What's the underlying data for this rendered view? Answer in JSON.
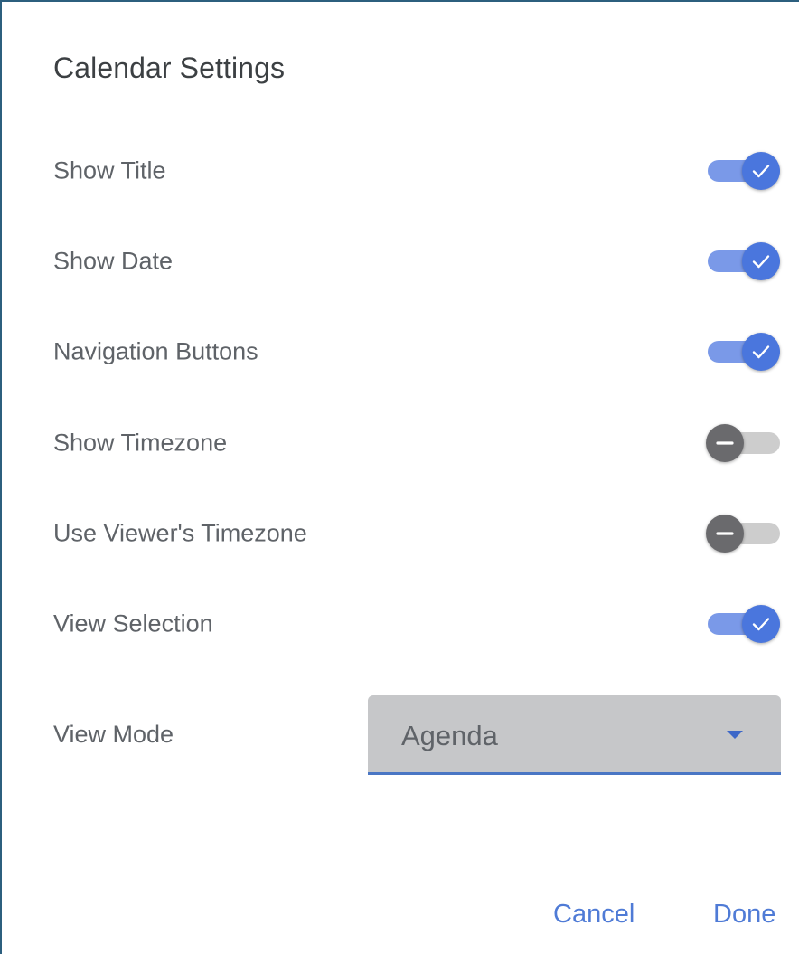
{
  "dialog": {
    "title": "Calendar Settings"
  },
  "settings": [
    {
      "label": "Show Title",
      "on": true
    },
    {
      "label": "Show Date",
      "on": true
    },
    {
      "label": "Navigation Buttons",
      "on": true
    },
    {
      "label": "Show Timezone",
      "on": false
    },
    {
      "label": "Use Viewer's Timezone",
      "on": false
    },
    {
      "label": "View Selection",
      "on": true
    }
  ],
  "view_mode": {
    "label": "View Mode",
    "value": "Agenda"
  },
  "actions": {
    "cancel_label": "Cancel",
    "done_label": "Done"
  },
  "colors": {
    "accent": "#4a76dd",
    "track_on": "#7a99e8",
    "knob_off": "#6a6a6d",
    "track_off": "#cdcdcd",
    "button_text": "#4f7bd6"
  },
  "icons": {
    "on": "check-icon",
    "off": "minus-icon"
  }
}
